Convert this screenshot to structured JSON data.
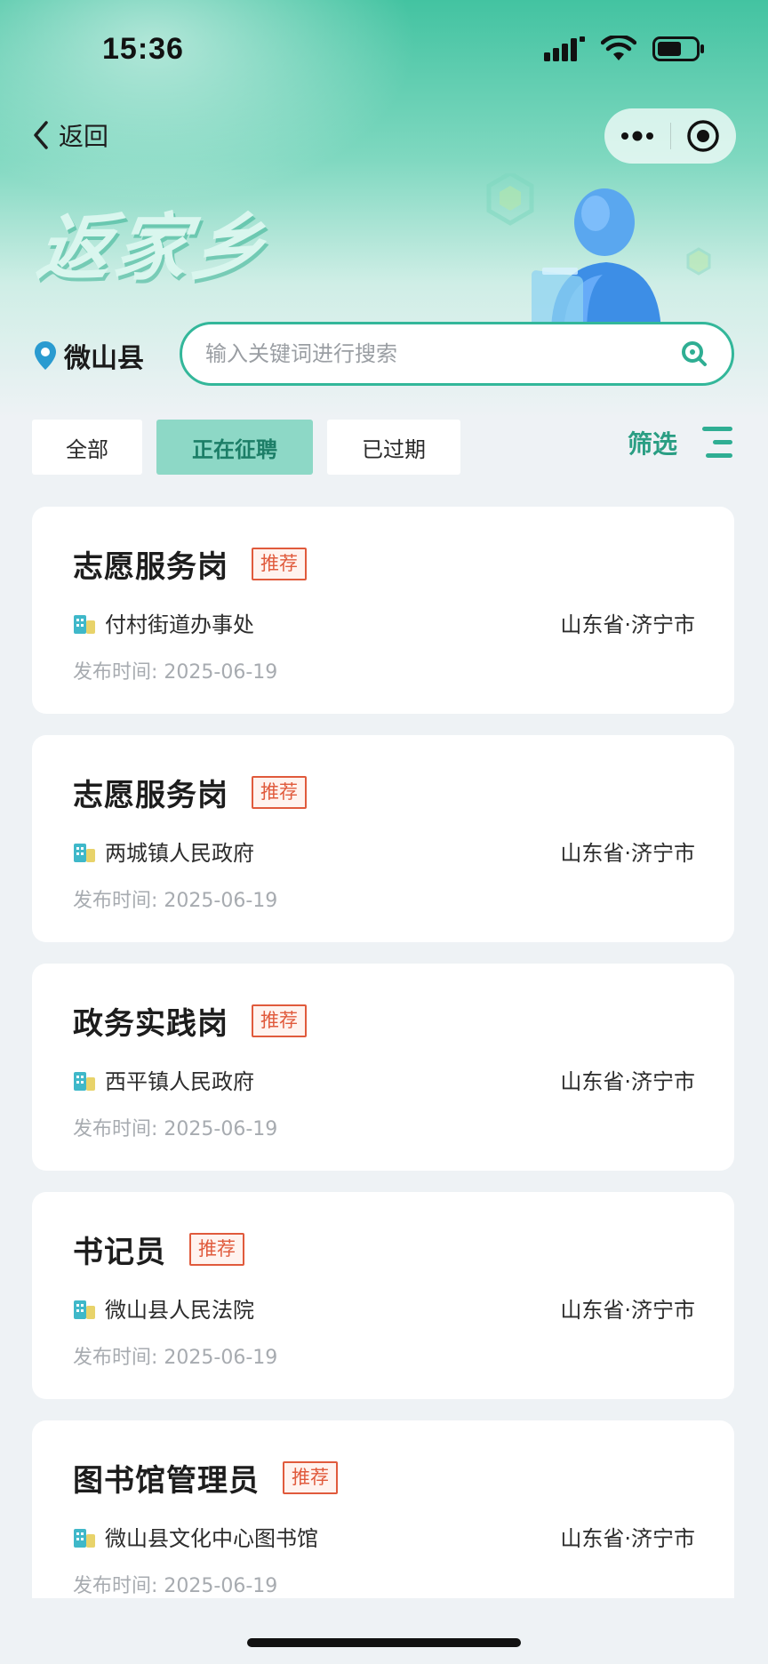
{
  "status_bar": {
    "time": "15:36"
  },
  "nav": {
    "back_label": "返回"
  },
  "hero": {
    "title": "返家乡"
  },
  "location": {
    "county": "微山县"
  },
  "search": {
    "placeholder": "输入关键词进行搜索"
  },
  "tabs": [
    {
      "label": "全部",
      "active": false
    },
    {
      "label": "正在征聘",
      "active": true
    },
    {
      "label": "已过期",
      "active": false
    }
  ],
  "filter": {
    "label": "筛选"
  },
  "colors": {
    "accent": "#33b79a",
    "tag": "#e05a3c",
    "active_tab_bg": "#8dd8c6"
  },
  "jobs": [
    {
      "title": "志愿服务岗",
      "tag": "推荐",
      "org": "付村街道办事处",
      "region": "山东省·济宁市",
      "date": "发布时间: 2025-06-19"
    },
    {
      "title": "志愿服务岗",
      "tag": "推荐",
      "org": "两城镇人民政府",
      "region": "山东省·济宁市",
      "date": "发布时间: 2025-06-19"
    },
    {
      "title": "政务实践岗",
      "tag": "推荐",
      "org": "西平镇人民政府",
      "region": "山东省·济宁市",
      "date": "发布时间: 2025-06-19"
    },
    {
      "title": "书记员",
      "tag": "推荐",
      "org": "微山县人民法院",
      "region": "山东省·济宁市",
      "date": "发布时间: 2025-06-19"
    },
    {
      "title": "图书馆管理员",
      "tag": "推荐",
      "org": "微山县文化中心图书馆",
      "region": "山东省·济宁市",
      "date": "发布时间: 2025-06-19"
    }
  ]
}
